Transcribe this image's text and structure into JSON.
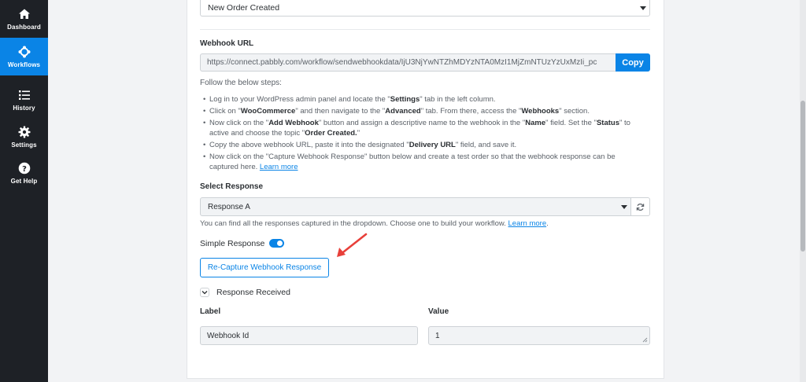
{
  "sidebar": {
    "items": [
      {
        "label": "Dashboard",
        "icon": "home-icon",
        "active": false
      },
      {
        "label": "Workflows",
        "icon": "workflow-icon",
        "active": true
      },
      {
        "label": "History",
        "icon": "list-icon",
        "active": false
      },
      {
        "label": "Settings",
        "icon": "gear-icon",
        "active": false
      },
      {
        "label": "Get Help",
        "icon": "question-icon",
        "active": false
      }
    ]
  },
  "trigger": {
    "event_value": "New Order Created"
  },
  "webhook": {
    "label": "Webhook URL",
    "url": "https://connect.pabbly.com/workflow/sendwebhookdata/IjU3NjYwNTZhMDYzNTA0MzI1MjZmNTUzYzUxMzIi_pc",
    "copy_label": "Copy"
  },
  "steps": {
    "title": "Follow the below steps:",
    "items": [
      {
        "parts": [
          [
            "Log in to your WordPress admin panel and locate the \"",
            false
          ],
          [
            "Settings",
            true
          ],
          [
            "\" tab in the left column.",
            false
          ]
        ]
      },
      {
        "parts": [
          [
            "Click on \"",
            false
          ],
          [
            "WooCommerce",
            true
          ],
          [
            "\" and then navigate to the \"",
            false
          ],
          [
            "Advanced",
            true
          ],
          [
            "\" tab. From there, access the \"",
            false
          ],
          [
            "Webhooks",
            true
          ],
          [
            "\" section.",
            false
          ]
        ]
      },
      {
        "parts": [
          [
            "Now click on the \"",
            false
          ],
          [
            "Add Webhook",
            true
          ],
          [
            "\" button and assign a descriptive name to the webhook in the \"",
            false
          ],
          [
            "Name",
            true
          ],
          [
            "\" field. Set the \"",
            false
          ],
          [
            "Status",
            true
          ],
          [
            "\" to active and choose the topic \"",
            false
          ],
          [
            "Order Created.",
            true
          ],
          [
            "\"",
            false
          ]
        ]
      },
      {
        "parts": [
          [
            "Copy the above webhook URL, paste it into the designated \"",
            false
          ],
          [
            "Delivery URL",
            true
          ],
          [
            "\" field, and save it.",
            false
          ]
        ]
      },
      {
        "parts": [
          [
            "Now click on the \"Capture Webhook Response\" button below and create a test order so that the webhook response can be captured here. ",
            false
          ]
        ],
        "link": "Learn more"
      }
    ]
  },
  "response": {
    "label": "Select Response",
    "selected": "Response A",
    "hint": "You can find all the responses captured in the dropdown. Choose one to build your workflow. ",
    "hint_link": "Learn more",
    "hint_end": "."
  },
  "simple_response": {
    "label": "Simple Response",
    "enabled": true
  },
  "recapture": {
    "label": "Re-Capture Webhook Response"
  },
  "received": {
    "label": "Response Received",
    "col_label": "Label",
    "col_value": "Value",
    "row_label": "Webhook Id",
    "row_value": "1"
  },
  "colors": {
    "accent": "#0a84e6",
    "sidebar_bg": "#1e2126",
    "arrow": "#e8403a"
  }
}
